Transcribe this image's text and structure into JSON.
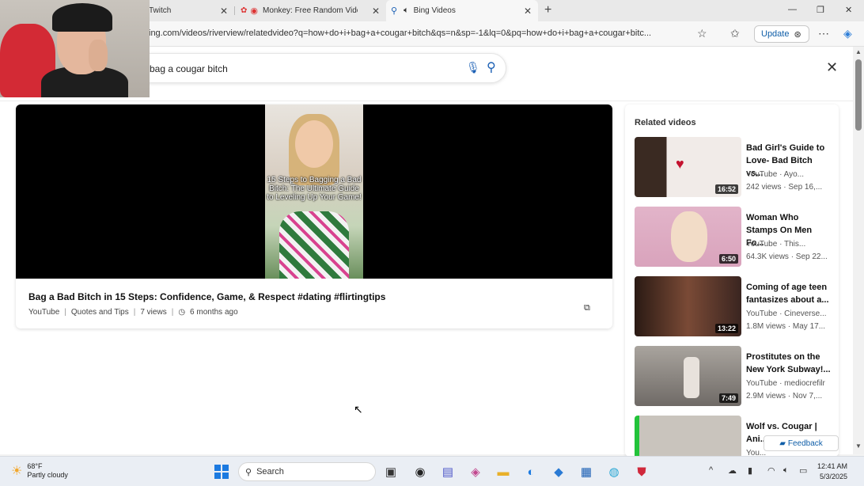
{
  "browser": {
    "tabs": [
      {
        "title": "Twitch",
        "icon": "twitch-icon"
      },
      {
        "title": "Monkey: Free Random Vide",
        "icon": "monkey-icon"
      },
      {
        "title": "Bing Videos",
        "icon": "bing-search-icon",
        "active": true
      }
    ],
    "url": "ing.com/videos/riverview/relatedvideo?q=how+do+i+bag+a+cougar+bitch&qs=n&sp=-1&lq=0&pq=how+do+i+bag+a+cougar+bitc...",
    "update_label": "Update"
  },
  "search": {
    "query": "bag a cougar bitch"
  },
  "video": {
    "overlay_text": "15 Steps to Bagging a Bad Bitch: The Ultimate Guide to Leveling Up Your Game!",
    "title": "Bag a Bad Bitch in 15 Steps: Confidence, Game, & Respect #dating #flirtingtips",
    "source": "YouTube",
    "channel": "Quotes and Tips",
    "views": "7 views",
    "age": "6 months ago"
  },
  "related": {
    "heading": "Related videos",
    "items": [
      {
        "title": "Bad Girl's Guide to Love- Bad Bitch vs...",
        "source": "YouTube · Ayo...",
        "stats": "242 views · Sep 16,...",
        "duration": "16:52",
        "thumb_color": "#d8d0cc"
      },
      {
        "title": "Woman Who Stamps On Men Fo...",
        "source": "YouTube · This...",
        "stats": "64.3K views · Sep 22...",
        "duration": "6:50",
        "thumb_color": "#d5a9c0"
      },
      {
        "title": "Coming of age teen fantasizes about a...",
        "source": "YouTube · Cineverse...",
        "stats": "1.8M views · May 17...",
        "duration": "13:22",
        "thumb_color": "#5a3a2e"
      },
      {
        "title": "Prostitutes on the New York Subway!...",
        "source": "YouTube · mediocrefilr",
        "stats": "2.9M views · Nov 7,...",
        "duration": "7:49",
        "thumb_color": "#8f8a84"
      },
      {
        "title": "Wolf vs. Cougar | Ani...",
        "source": "You...",
        "stats": "",
        "duration": "",
        "thumb_color": "#b8b4ae"
      }
    ]
  },
  "feedback_label": "Feedback",
  "taskbar": {
    "weather_temp": "68°F",
    "weather_desc": "Partly cloudy",
    "search_placeholder": "Search",
    "time": "12:41 AM",
    "date": "5/3/2025"
  }
}
